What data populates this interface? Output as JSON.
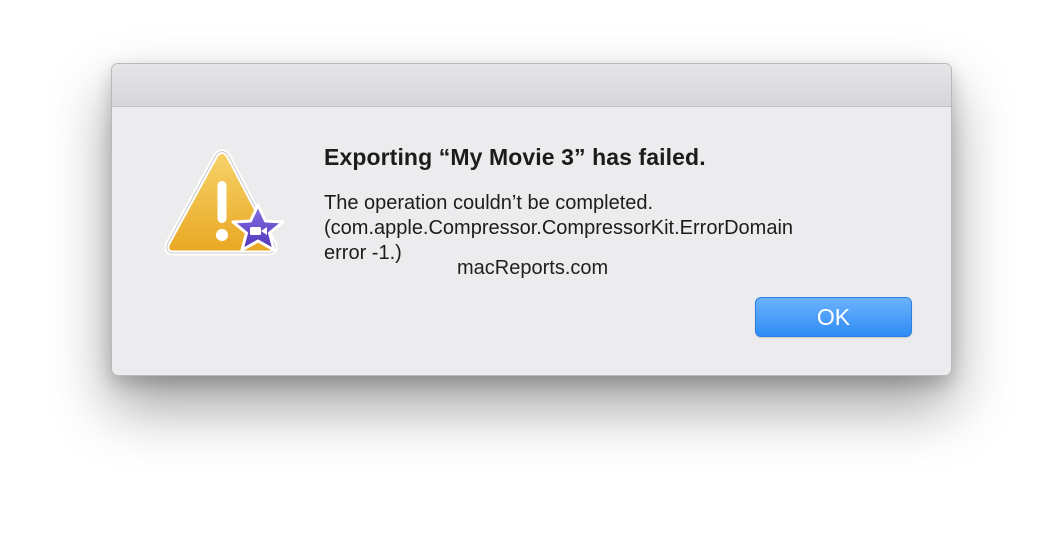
{
  "dialog": {
    "title": "Exporting “My Movie 3” has failed.",
    "message_lines": [
      "The operation couldn’t be completed.",
      "(com.apple.Compressor.CompressorKit.ErrorDomain",
      "error -1.)"
    ],
    "ok_label": "OK",
    "icon": "warning-triangle-with-imovie-star-icon"
  },
  "watermark": "macReports.com",
  "colors": {
    "button_blue": "#3d93f7",
    "warning_yellow": "#f1b936",
    "star_purple": "#6a4fd1",
    "dialog_background": "#ecebed"
  }
}
